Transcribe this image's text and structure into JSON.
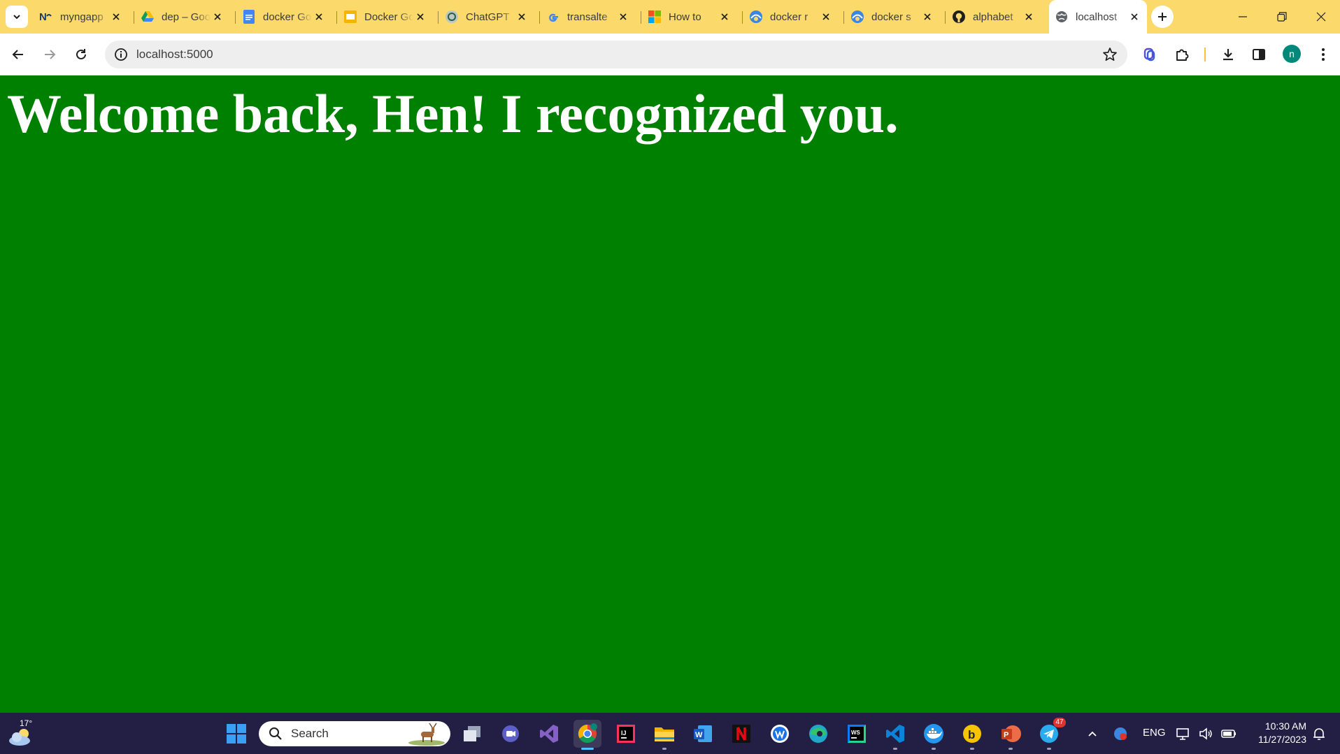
{
  "tabs": [
    {
      "title": "myngapp",
      "icon": "n-logo-icon"
    },
    {
      "title": "dep – Google Drive",
      "icon": "google-drive-icon"
    },
    {
      "title": "docker Google Docs",
      "icon": "google-docs-icon"
    },
    {
      "title": "Docker Google Slides",
      "icon": "google-slides-icon"
    },
    {
      "title": "ChatGPT",
      "icon": "chatgpt-icon"
    },
    {
      "title": "transalte",
      "icon": "google-icon"
    },
    {
      "title": "How to",
      "icon": "microsoft-icon"
    },
    {
      "title": "docker r",
      "icon": "docker-web-icon"
    },
    {
      "title": "docker s",
      "icon": "docker-web-icon"
    },
    {
      "title": "alphabet",
      "icon": "github-icon"
    },
    {
      "title": "localhost",
      "icon": "globe-icon",
      "active": true
    }
  ],
  "address_bar": {
    "url": "localhost:5000"
  },
  "profile": {
    "initial": "n"
  },
  "page": {
    "heading": "Welcome back, Hen! I recognized you."
  },
  "colors": {
    "page_background": "#008000",
    "tab_strip": "#fbd96a",
    "taskbar": "#231f44"
  },
  "taskbar": {
    "weather_temp": "17°",
    "search_placeholder": "Search",
    "telegram_badge": "47",
    "language": "ENG",
    "time": "10:30 AM",
    "date": "11/27/2023"
  }
}
